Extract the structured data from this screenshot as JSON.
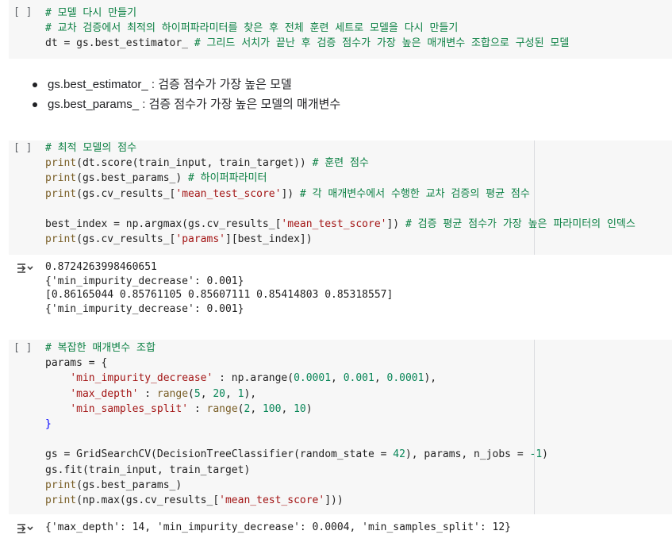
{
  "cells": [
    {
      "run_label": "[ ]",
      "lines": [
        [
          {
            "t": "# 모델 다시 만들기",
            "c": "cm"
          }
        ],
        [
          {
            "t": "# 교차 검증에서 최적의 하이퍼파라미터를 찾은 후 전체 훈련 세트로 모델을 다시 만들기",
            "c": "cm"
          }
        ],
        [
          {
            "t": "dt = gs.best_estimator_ "
          },
          {
            "t": "# 그리드 서치가 끝난 후 검증 점수가 가장 높은 매개변수 조합으로 구성된 모델",
            "c": "cm"
          }
        ]
      ]
    },
    {
      "run_label": "[ ]",
      "lines": [
        [
          {
            "t": "# 최적 모델의 점수",
            "c": "cm"
          }
        ],
        [
          {
            "t": "print",
            "c": "fn"
          },
          {
            "t": "(dt.score(train_input, train_target)) "
          },
          {
            "t": "# 훈련 점수",
            "c": "cm"
          }
        ],
        [
          {
            "t": "print",
            "c": "fn"
          },
          {
            "t": "(gs.best_params_) "
          },
          {
            "t": "# 하이퍼파라미터",
            "c": "cm"
          }
        ],
        [
          {
            "t": "print",
            "c": "fn"
          },
          {
            "t": "(gs.cv_results_["
          },
          {
            "t": "'mean_test_score'",
            "c": "st"
          },
          {
            "t": "]) "
          },
          {
            "t": "# 각 매개변수에서 수행한 교차 검증의 평균 점수",
            "c": "cm"
          }
        ],
        [
          {
            "t": ""
          }
        ],
        [
          {
            "t": "best_index = np.argmax(gs.cv_results_["
          },
          {
            "t": "'mean_test_score'",
            "c": "st"
          },
          {
            "t": "]) "
          },
          {
            "t": "# 검증 평균 점수가 가장 높은 파라미터의 인덱스",
            "c": "cm"
          }
        ],
        [
          {
            "t": "print",
            "c": "fn"
          },
          {
            "t": "(gs.cv_results_["
          },
          {
            "t": "'params'",
            "c": "st"
          },
          {
            "t": "][best_index])"
          }
        ]
      ]
    },
    {
      "run_label": "[ ]",
      "lines": [
        [
          {
            "t": "# 복잡한 매개변수 조합",
            "c": "cm"
          }
        ],
        [
          {
            "t": "params = {"
          }
        ],
        [
          {
            "t": "    "
          },
          {
            "t": "'min_impurity_decrease'",
            "c": "st"
          },
          {
            "t": " : np.arange("
          },
          {
            "t": "0.0001",
            "c": "nm"
          },
          {
            "t": ", "
          },
          {
            "t": "0.001",
            "c": "nm"
          },
          {
            "t": ", "
          },
          {
            "t": "0.0001",
            "c": "nm"
          },
          {
            "t": "),"
          }
        ],
        [
          {
            "t": "    "
          },
          {
            "t": "'max_depth'",
            "c": "st"
          },
          {
            "t": " : "
          },
          {
            "t": "range",
            "c": "fn"
          },
          {
            "t": "("
          },
          {
            "t": "5",
            "c": "nm"
          },
          {
            "t": ", "
          },
          {
            "t": "20",
            "c": "nm"
          },
          {
            "t": ", "
          },
          {
            "t": "1",
            "c": "nm"
          },
          {
            "t": "),"
          }
        ],
        [
          {
            "t": "    "
          },
          {
            "t": "'min_samples_split'",
            "c": "st"
          },
          {
            "t": " : "
          },
          {
            "t": "range",
            "c": "fn"
          },
          {
            "t": "("
          },
          {
            "t": "2",
            "c": "nm"
          },
          {
            "t": ", "
          },
          {
            "t": "100",
            "c": "nm"
          },
          {
            "t": ", "
          },
          {
            "t": "10",
            "c": "nm"
          },
          {
            "t": ")"
          }
        ],
        [
          {
            "t": "}",
            "c": "kw"
          }
        ],
        [
          {
            "t": ""
          }
        ],
        [
          {
            "t": "gs = GridSearchCV(DecisionTreeClassifier(random_state = "
          },
          {
            "t": "42",
            "c": "nm"
          },
          {
            "t": "), params, n_jobs = "
          },
          {
            "t": "-1",
            "c": "nm"
          },
          {
            "t": ")"
          }
        ],
        [
          {
            "t": "gs.fit(train_input, train_target)"
          }
        ],
        [
          {
            "t": "print",
            "c": "fn"
          },
          {
            "t": "(gs.best_params_)"
          }
        ],
        [
          {
            "t": "print",
            "c": "fn"
          },
          {
            "t": "(np.max(gs.cv_results_["
          },
          {
            "t": "'mean_test_score'",
            "c": "st"
          },
          {
            "t": "]))"
          }
        ]
      ]
    }
  ],
  "markdown_bullets": [
    {
      "code": "gs.best_estimator_",
      "text": " : 검증 점수가 가장 높은 모델"
    },
    {
      "code": "gs.best_params_",
      "text": " : 검증 점수가 가장 높은 모델의 매개변수"
    }
  ],
  "outputs": [
    {
      "icon": "output-toggle-icon",
      "lines": [
        "0.8724263998460651",
        "{'min_impurity_decrease': 0.001}",
        "[0.86165044 0.85761105 0.85607111 0.85414803 0.85318557]",
        "{'min_impurity_decrease': 0.001}"
      ]
    },
    {
      "icon": "output-toggle-icon",
      "lines": [
        "{'max_depth': 14, 'min_impurity_decrease': 0.0004, 'min_samples_split': 12}"
      ]
    }
  ]
}
